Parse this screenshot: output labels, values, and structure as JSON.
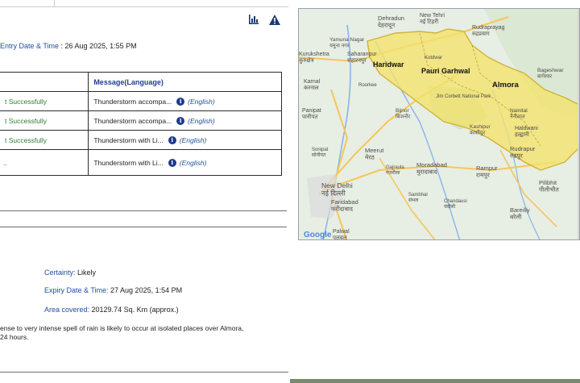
{
  "header": {
    "chart_icon": "bar-chart-icon",
    "alert_icon": "warning-triangle-icon",
    "entry_label": "Entry Date & Time",
    "entry_value": " : 26 Aug 2025, 1:55 PM"
  },
  "table": {
    "header_message": "Message(Language)",
    "rows": [
      {
        "status": "t Successfully",
        "message": "Thunderstorm accompa...",
        "info": "i",
        "language": "(English)"
      },
      {
        "status": "t Successfully",
        "message": "Thunderstorm accompa...",
        "info": "i",
        "language": "(English)"
      },
      {
        "status": "t Successfully",
        "message": "Thunderstorm with Li...",
        "info": "i",
        "language": "(English)"
      },
      {
        "status": "..",
        "message": "Thunderstorm with Li...",
        "info": "i",
        "language": "(English)"
      }
    ]
  },
  "details": {
    "certainty_label": "Certainty:",
    "certainty_value": " Likely",
    "expiry_label": "Expiry Date & Time:",
    "expiry_value": " 27 Aug 2025, 1:54 PM",
    "area_label": "Area covered:",
    "area_value": " 20129.74 Sq. Km (approx.)"
  },
  "description": {
    "line1": "ense to very intense spell of rain is likely to occur at isolated places over Almora,",
    "line2": "24 hours."
  },
  "map": {
    "colors": {
      "land": "#e7eee3",
      "alert": "#f3e36a",
      "alert_border": "#d2b23a",
      "road": "#f5c65b",
      "water": "#8ab4e8",
      "forest": "#cfe3c4"
    },
    "places": [
      {
        "name": "Dehradun",
        "local": "देहरादून"
      },
      {
        "name": "New Tehri",
        "local": "नई टिहरी"
      },
      {
        "name": "Rudraprayag",
        "local": "रुद्रप्रयाग"
      },
      {
        "name": "Haridwar",
        "local": ""
      },
      {
        "name": "Pauri Garhwal",
        "local": ""
      },
      {
        "name": "Almora",
        "local": ""
      },
      {
        "name": "Kurukshetra",
        "local": "कुरुक्षेत्र"
      },
      {
        "name": "Saharanpur",
        "local": "सहारनपुर"
      },
      {
        "name": "Yamuna Nagar",
        "local": "यमुना नगर"
      },
      {
        "name": "Karnal",
        "local": "करनाल"
      },
      {
        "name": "Panipat",
        "local": "पानीपत"
      },
      {
        "name": "Bijnor",
        "local": "बिजनौर"
      },
      {
        "name": "Bageshwar",
        "local": "बागेश्वर"
      },
      {
        "name": "Jim Corbett National Park",
        "local": ""
      },
      {
        "name": "Nainital",
        "local": "नैनीताल"
      },
      {
        "name": "Haldwani",
        "local": "हल्द्वानी"
      },
      {
        "name": "Kashipur",
        "local": "काशीपुर"
      },
      {
        "name": "Rudrapur",
        "local": "रुद्रपुर"
      },
      {
        "name": "Meerut",
        "local": "मेरठ"
      },
      {
        "name": "Moradabad",
        "local": "मुरादाबाद"
      },
      {
        "name": "Rampur",
        "local": "रामपुर"
      },
      {
        "name": "Pilibhit",
        "local": "पीलीभीत"
      },
      {
        "name": "Sonipat",
        "local": "सोनीपत"
      },
      {
        "name": "Gajraula",
        "local": "गजरौला"
      },
      {
        "name": "New Delhi",
        "local": "नई दिल्ली"
      },
      {
        "name": "Faridabad",
        "local": "फरीदाबाद"
      },
      {
        "name": "Sambhal",
        "local": "संभल"
      },
      {
        "name": "Chandausi",
        "local": "चंदौसी"
      },
      {
        "name": "Bareilly",
        "local": "बरेली"
      },
      {
        "name": "Palwal",
        "local": "पलवल"
      },
      {
        "name": "Roorkee",
        "local": ""
      },
      {
        "name": "Kotdwar",
        "local": ""
      },
      {
        "name": "Google",
        "local": ""
      }
    ]
  }
}
